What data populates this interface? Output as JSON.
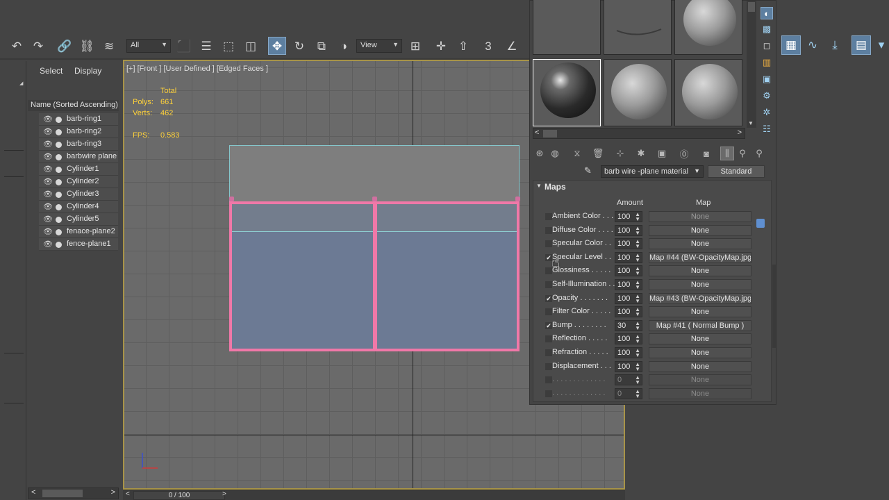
{
  "toolbar": {
    "selection_filter": "All",
    "reference_coord": "View",
    "icons": [
      "undo-icon",
      "redo-icon",
      "link-icon",
      "unlink-icon",
      "bind-spacewarp-icon",
      "select-object-icon",
      "select-by-name-icon",
      "rect-select-icon",
      "window-crossing-icon",
      "move-icon",
      "rotate-icon",
      "scale-icon",
      "select-manipulate-icon",
      "keyboard-shortcut-icon",
      "pivot-icon",
      "snaps-icon",
      "angle-snap-icon"
    ]
  },
  "explorer": {
    "tab_select": "Select",
    "tab_display": "Display",
    "column_header": "Name (Sorted Ascending)",
    "items": [
      {
        "name": "barb-ring1"
      },
      {
        "name": "barb-ring2"
      },
      {
        "name": "barb-ring3"
      },
      {
        "name": "barbwire plane"
      },
      {
        "name": "Cylinder1"
      },
      {
        "name": "Cylinder2"
      },
      {
        "name": "Cylinder3"
      },
      {
        "name": "Cylinder4"
      },
      {
        "name": "Cylinder5"
      },
      {
        "name": "fenace-plane2"
      },
      {
        "name": "fence-plane1"
      }
    ]
  },
  "viewport": {
    "label": "[+] [Front ] [User Defined ] [Edged Faces ]",
    "stats": {
      "total_label": "Total",
      "polys_label": "Polys:",
      "polys_value": "661",
      "verts_label": "Verts:",
      "verts_value": "462",
      "fps_label": "FPS:",
      "fps_value": "0.583"
    }
  },
  "timeline": {
    "frame": "0 / 100",
    "prev": "<",
    "next": ">"
  },
  "material_editor": {
    "material_name": "barb wire -plane material",
    "material_type": "Standard",
    "maps_title": "Maps",
    "col_amount": "Amount",
    "col_map": "Map",
    "rows": [
      {
        "label": "Ambient Color . . .",
        "checked": false,
        "amount": "100",
        "map": "None",
        "dim_map": true
      },
      {
        "label": "Diffuse Color . . . .",
        "checked": false,
        "amount": "100",
        "map": "None"
      },
      {
        "label": "Specular Color . .",
        "checked": false,
        "amount": "100",
        "map": "None"
      },
      {
        "label": "Specular Level . .",
        "checked": true,
        "amount": "100",
        "map": "Map #44 (BW-OpacityMap.jpg)"
      },
      {
        "label": "Glossiness . . . . .",
        "checked": false,
        "amount": "100",
        "map": "None"
      },
      {
        "label": "Self-Illumination . .",
        "checked": false,
        "amount": "100",
        "map": "None"
      },
      {
        "label": "Opacity . . . . . . .",
        "checked": true,
        "amount": "100",
        "map": "Map #43 (BW-OpacityMap.jpg)"
      },
      {
        "label": "Filter Color . . . . .",
        "checked": false,
        "amount": "100",
        "map": "None"
      },
      {
        "label": "Bump . . . . . . . .",
        "checked": true,
        "amount": "30",
        "map": "Map #41  ( Normal Bump )"
      },
      {
        "label": "Reflection . . . . .",
        "checked": false,
        "amount": "100",
        "map": "None"
      },
      {
        "label": "Refraction . . . . .",
        "checked": false,
        "amount": "100",
        "map": "None"
      },
      {
        "label": "Displacement . . .",
        "checked": false,
        "amount": "100",
        "map": "None"
      },
      {
        "label": ". . . . . . . . . . . . .",
        "checked": false,
        "amount": "0",
        "map": "None",
        "dim": true
      },
      {
        "label": ". . . . . . . . . . . . .",
        "checked": false,
        "amount": "0",
        "map": "None",
        "dim": true
      }
    ]
  },
  "colors": {
    "selection_pink": "#f078a8",
    "active_blue": "#5d7fa0",
    "stats_yellow": "#ffd23a",
    "viewport_border": "#a89448"
  }
}
